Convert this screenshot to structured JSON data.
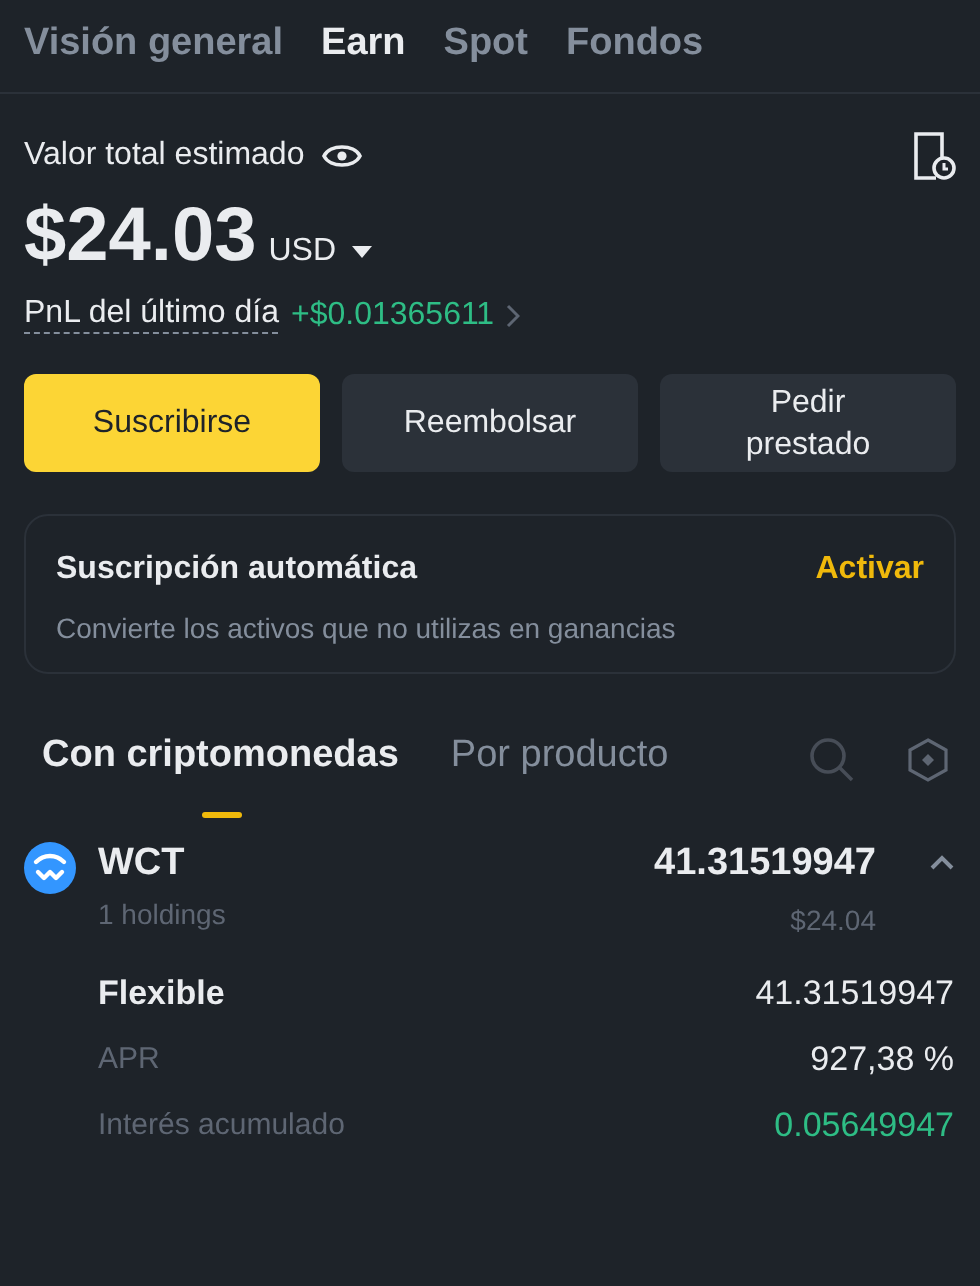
{
  "tabs": [
    {
      "label": "Visión general",
      "selected": false
    },
    {
      "label": "Earn",
      "selected": true
    },
    {
      "label": "Spot",
      "selected": false
    },
    {
      "label": "Fondos",
      "selected": false
    }
  ],
  "summary": {
    "label": "Valor total estimado",
    "amount": "$24.03",
    "currency": "USD",
    "pnl_label": "PnL del último día",
    "pnl_value": "+$0.01365611"
  },
  "actions": [
    {
      "label": "Suscribirse",
      "kind": "primary"
    },
    {
      "label": "Reembolsar",
      "kind": "secondary"
    },
    {
      "label": "Pedir prestado",
      "kind": "secondary"
    }
  ],
  "auto_subscribe": {
    "title": "Suscripción automática",
    "action": "Activar",
    "description": "Convierte los activos que no utilizas en ganancias"
  },
  "view_tabs": [
    {
      "label": "Con criptomonedas",
      "selected": true
    },
    {
      "label": "Por producto",
      "selected": false
    }
  ],
  "asset": {
    "symbol": "WCT",
    "holdings": "1 holdings",
    "amount": "41.31519947",
    "value": "$24.04",
    "expanded": true,
    "details": [
      {
        "label": "Flexible",
        "value": "41.31519947",
        "kind": "heading"
      },
      {
        "label": "APR",
        "value": "927,38 %",
        "kind": "plain"
      },
      {
        "label": "Interés acumulado",
        "value": "0.05649947",
        "kind": "positive"
      }
    ]
  }
}
